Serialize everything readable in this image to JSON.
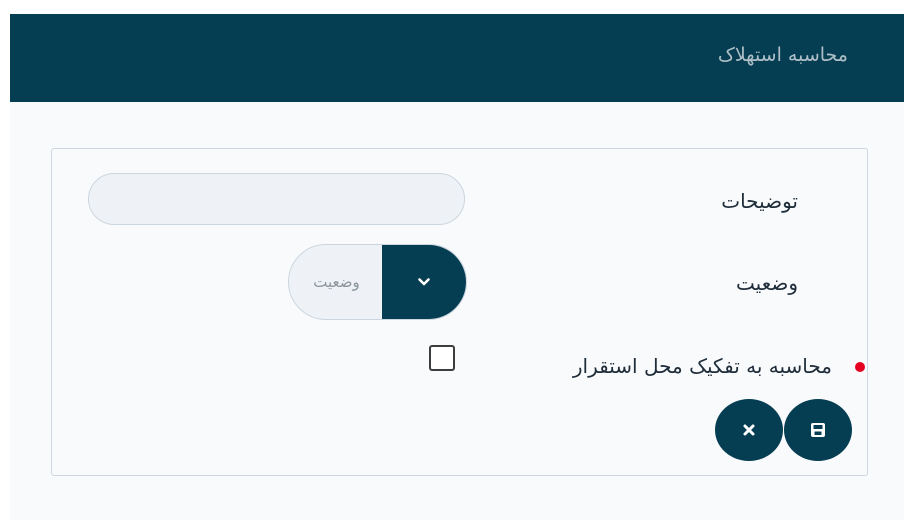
{
  "header": {
    "title": "محاسبه استهلاک"
  },
  "form": {
    "description_label": "توضیحات",
    "description_value": "",
    "status_label": "وضعیت",
    "status_placeholder": "وضعیت",
    "separate_label": "محاسبه به تفکیک محل استقرار",
    "separate_checked": false,
    "required": true
  },
  "buttons": {
    "save_icon": "save-icon",
    "cancel_icon": "close-icon"
  },
  "colors": {
    "primary": "#053d52",
    "required_dot": "#e6001f",
    "background": "#f9fafc"
  }
}
